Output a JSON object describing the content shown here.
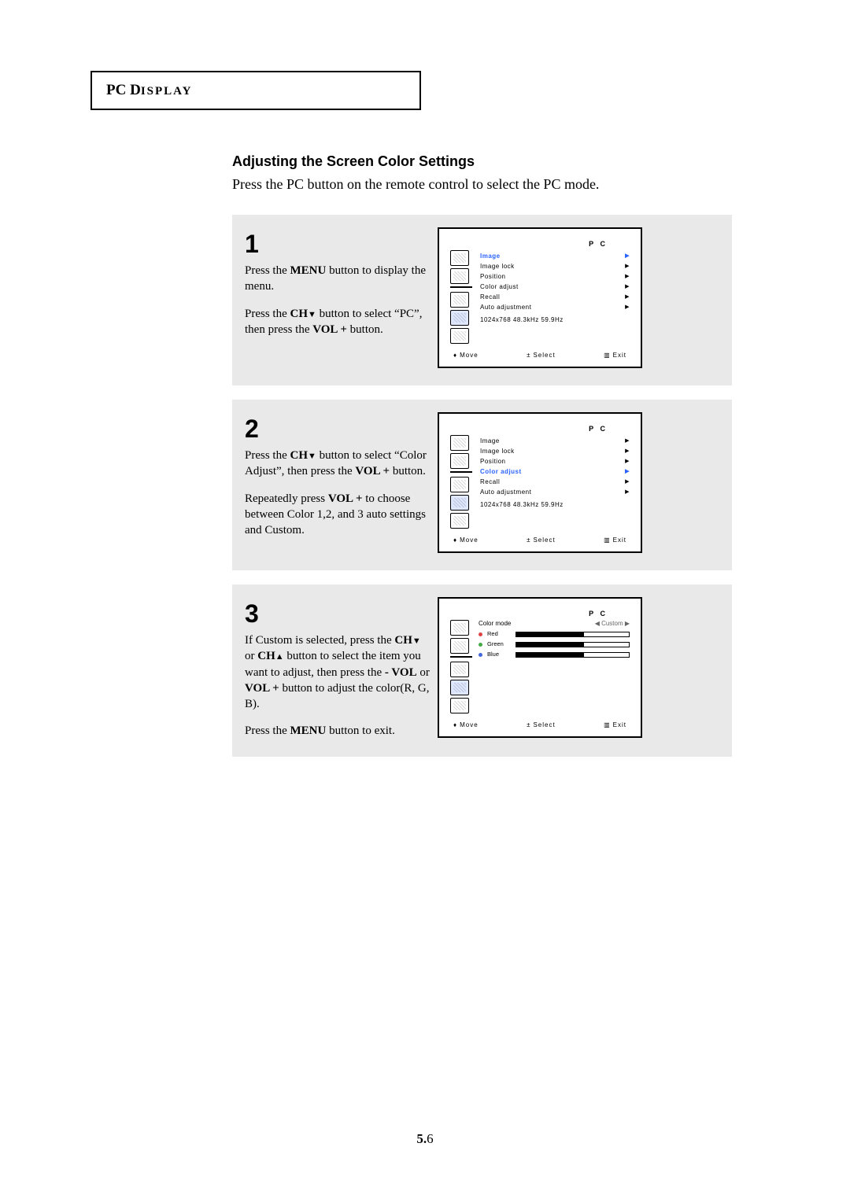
{
  "section_label": {
    "prefix": "PC D",
    "rest": "ISPLAY"
  },
  "sub_head": "Adjusting the Screen Color Settings",
  "intro": "Press the PC button on the remote control to select the PC mode.",
  "steps": {
    "s1": {
      "num": "1",
      "p1a": "Press the ",
      "p1b": "MENU",
      "p1c": " button to display the menu.",
      "p2a": "Press the ",
      "p2b": "CH",
      "p2c": "▼",
      "p2d": " button to select “PC”, then press the ",
      "p2e": "VOL +",
      "p2f": " button."
    },
    "s2": {
      "num": "2",
      "p1a": "Press the ",
      "p1b": "CH",
      "p1c": "▼",
      "p1d": " button to select “Color Adjust”, then press the ",
      "p1e": "VOL +",
      "p1f": " button.",
      "p2a": "Repeatedly press ",
      "p2b": "VOL +",
      "p2c": " to choose between Color 1,2, and 3 auto settings and Custom."
    },
    "s3": {
      "num": "3",
      "p1a": "If Custom is selected, press the ",
      "p1b": "CH",
      "p1c": "▼",
      "p1d": " or ",
      "p1e": "CH",
      "p1f": "▲",
      "p1g": " button to select the item you want to adjust, then press the ",
      "p1h": "- VOL",
      "p1i": " or ",
      "p1j": "VOL +",
      "p1k": " button to adjust the color(R, G, B).",
      "p2a": "Press the ",
      "p2b": "MENU",
      "p2c": " button to exit."
    }
  },
  "osd": {
    "title": "P C",
    "items": {
      "image": "Image",
      "image_lock": "Image lock",
      "position": "Position",
      "color_adjust": "Color adjust",
      "recall": "Recall",
      "auto_adjustment": "Auto adjustment"
    },
    "resolution": "1024x768  48.3kHz 59.9Hz",
    "footer": {
      "move": "Move",
      "select": "Select",
      "exit": "Exit"
    }
  },
  "osd3": {
    "color_mode_label": "Color mode",
    "color_mode_value": "Custom",
    "red": "Red",
    "green": "Green",
    "blue": "Blue"
  },
  "page_num": {
    "chapter": "5.",
    "page": "6"
  }
}
